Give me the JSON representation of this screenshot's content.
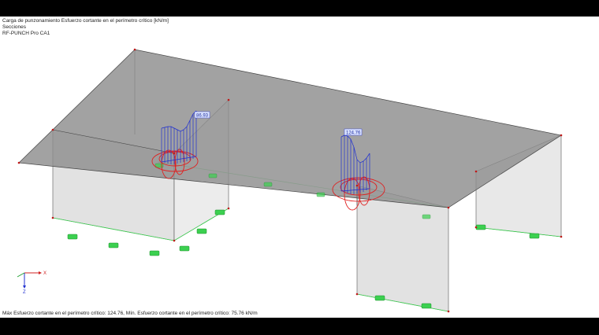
{
  "info": {
    "line1": "Carga de punzonamiento Esfuerzo cortante en el perímetro crítico [kN/m]",
    "line2": "Secciones",
    "line3": "RF-PUNCH Pro CA1"
  },
  "labels": {
    "left_value": "86.93",
    "right_value": "124.76"
  },
  "axes": {
    "x": "X",
    "z": "Z"
  },
  "status_text": "Máx Esfuerzo cortante en el perímetro crítico: 124.76, Mín. Esfuerzo cortante en el perímetro crítico: 75.76 kN/m",
  "colors": {
    "slab": "#8e8e8e",
    "wall": "#e4e4e4",
    "diagram": "#1f2fd0",
    "perimeter": "#e02020",
    "support": "#3cd050",
    "node": "#c01818"
  }
}
